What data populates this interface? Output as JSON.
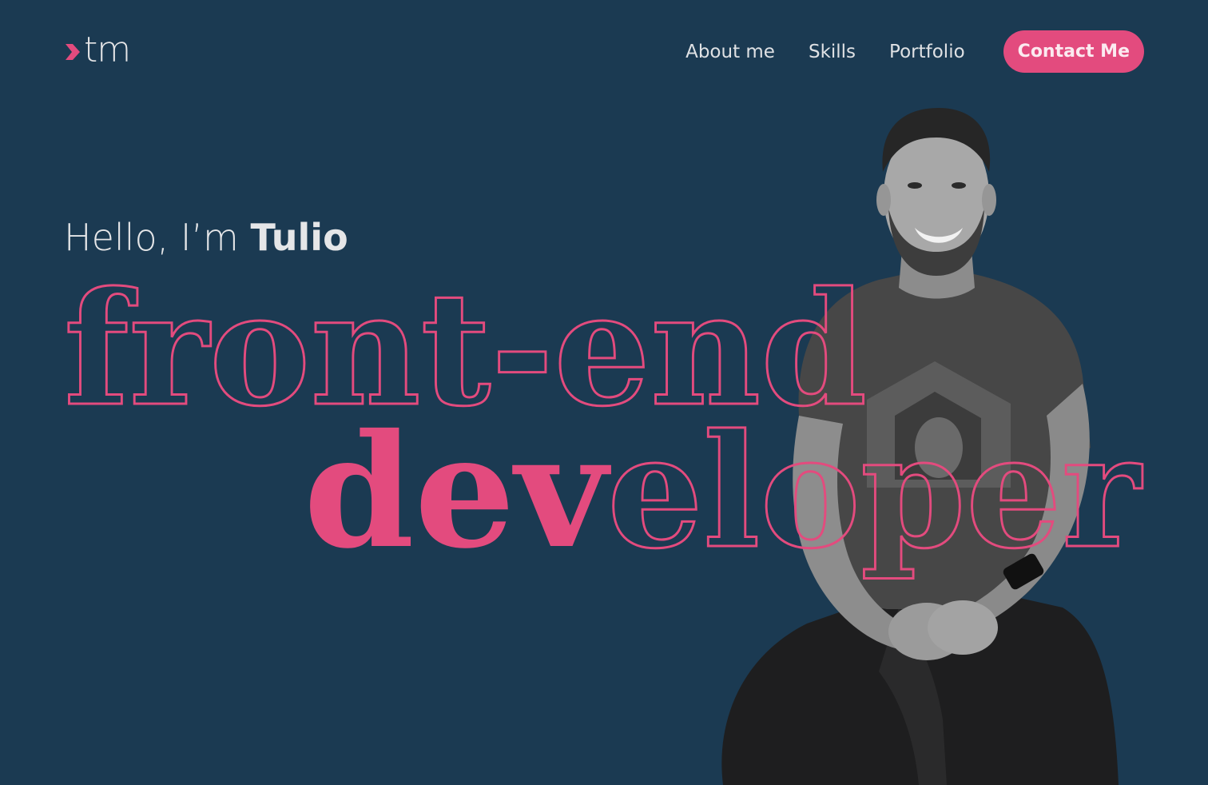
{
  "header": {
    "logo": {
      "icon": "chevron-right-icon",
      "text": "tm"
    },
    "nav": [
      {
        "label": "About me"
      },
      {
        "label": "Skills"
      },
      {
        "label": "Portfolio"
      }
    ],
    "cta_label": "Contact Me"
  },
  "hero": {
    "greeting_prefix": "Hello, I’m ",
    "greeting_name": "Tulio",
    "headline_line1": "front-end",
    "headline_line2_filled": "dev",
    "headline_line2_outline": "eloper",
    "photo": "portrait-photo"
  },
  "colors": {
    "background": "#1b3a52",
    "accent": "#e34b7e",
    "text": "#e5e6e8"
  }
}
